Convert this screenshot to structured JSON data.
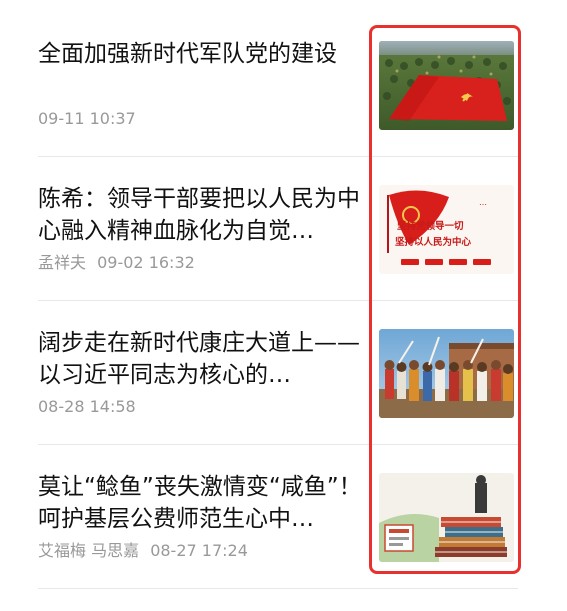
{
  "articles": [
    {
      "title": "全面加强新时代军队党的建设",
      "author": "",
      "time": "09-11 10:37",
      "thumb": "red-flag-field-photo"
    },
    {
      "title": "陈希：领导干部要把以人民为中心融入精神血脉化为自觉…",
      "author": "孟祥夫",
      "time": "09-02 16:32",
      "thumb": "party-flag-banner",
      "thumb_text": [
        "坚持党领导一切",
        "坚持以人民为中心"
      ]
    },
    {
      "title": "阔步走在新时代康庄大道上——以习近平同志为核心的…",
      "author": "",
      "time": "08-28 14:58",
      "thumb": "crowd-gathering-photo"
    },
    {
      "title": "莫让“鲶鱼”丧失激情变“咸鱼”！呵护基层公费师范生心中…",
      "author": "艾福梅 马思嘉",
      "time": "08-27 17:24",
      "thumb": "teacher-books-cartoon"
    }
  ],
  "highlight_color": "#e8312f"
}
